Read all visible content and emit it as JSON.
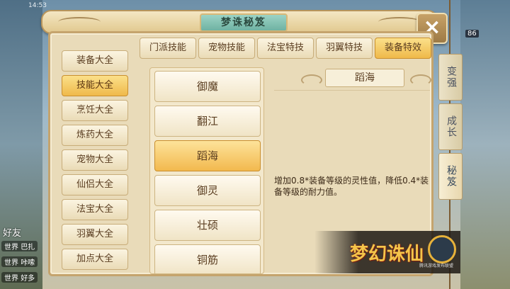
{
  "status": {
    "time": "14:53",
    "level_badge": "86"
  },
  "background": {
    "left_label": "好友",
    "chat": [
      {
        "channel": "世界",
        "text": "巴扎"
      },
      {
        "channel": "世界",
        "text": "咔嗦"
      },
      {
        "channel": "世界",
        "text": "好多"
      }
    ]
  },
  "panel": {
    "title": "梦诛秘笈",
    "close_label": "×"
  },
  "sidebar": {
    "items": [
      {
        "label": "装备大全",
        "active": false
      },
      {
        "label": "技能大全",
        "active": true
      },
      {
        "label": "烹饪大全",
        "active": false
      },
      {
        "label": "炼药大全",
        "active": false
      },
      {
        "label": "宠物大全",
        "active": false
      },
      {
        "label": "仙侣大全",
        "active": false
      },
      {
        "label": "法宝大全",
        "active": false
      },
      {
        "label": "羽翼大全",
        "active": false
      },
      {
        "label": "加点大全",
        "active": false
      }
    ]
  },
  "tabs": [
    {
      "label": "门派技能",
      "active": false
    },
    {
      "label": "宠物技能",
      "active": false
    },
    {
      "label": "法宝特技",
      "active": false
    },
    {
      "label": "羽翼特技",
      "active": false
    },
    {
      "label": "装备特效",
      "active": true
    }
  ],
  "skill_list": [
    {
      "label": "御魔",
      "active": false
    },
    {
      "label": "翻江",
      "active": false
    },
    {
      "label": "蹈海",
      "active": true
    },
    {
      "label": "御灵",
      "active": false
    },
    {
      "label": "壮硕",
      "active": false
    },
    {
      "label": "铜筋",
      "active": false
    }
  ],
  "detail": {
    "title": "蹈海",
    "description": "增加0.8*装备等级的灵性值，降低0.4*装备等级的耐力值。"
  },
  "right_tabs": [
    {
      "label": "变强",
      "active": false
    },
    {
      "label": "成长",
      "active": false
    },
    {
      "label": "秘笈",
      "active": true
    }
  ],
  "logo": {
    "text": "梦幻诛仙",
    "badge_text": "腾讯游戏发布联盟"
  },
  "colors": {
    "accent": "#efb94a",
    "panel_bg": "#e9dbb9",
    "border": "#c5a46d"
  }
}
